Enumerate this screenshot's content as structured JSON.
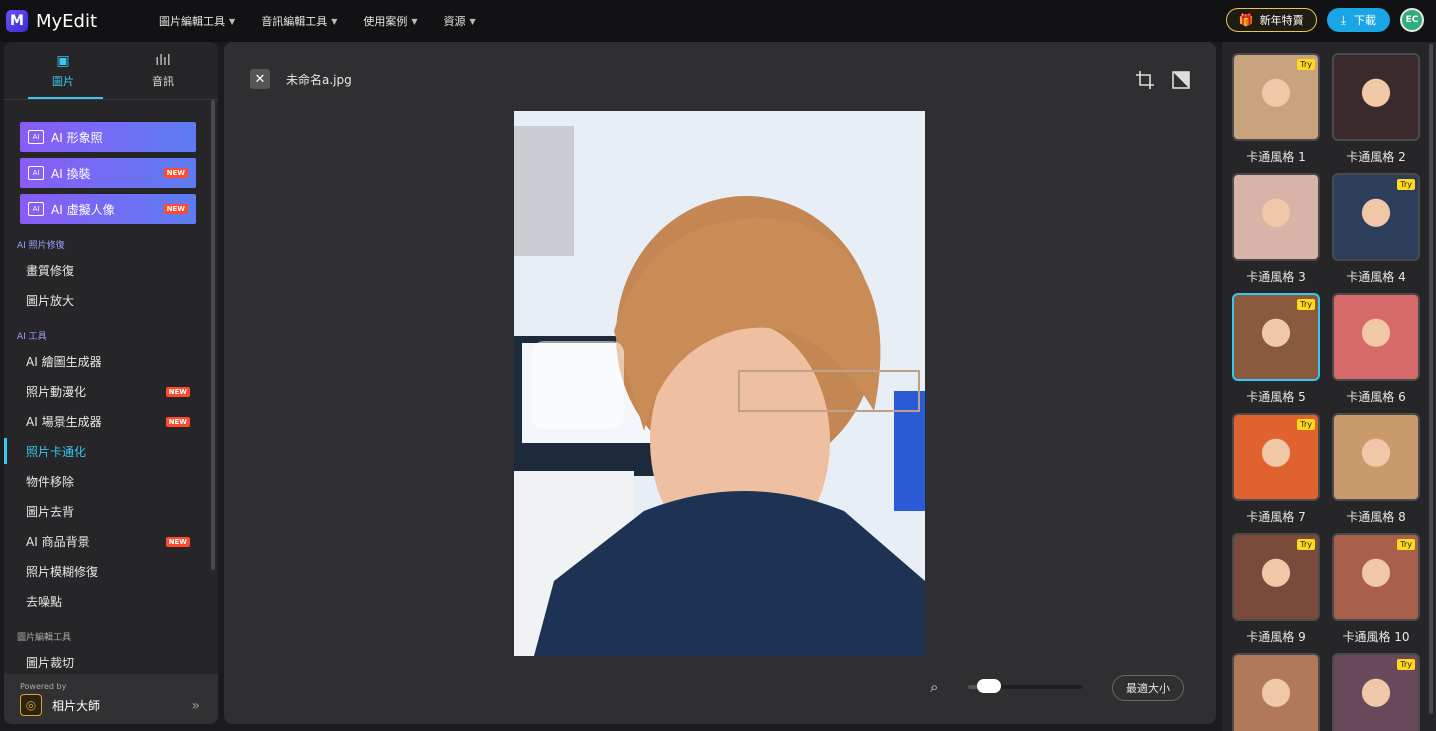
{
  "app": {
    "name": "MyEdit",
    "logo_letter": "M"
  },
  "nav": [
    {
      "label": "圖片編輯工具"
    },
    {
      "label": "音訊編輯工具"
    },
    {
      "label": "使用案例"
    },
    {
      "label": "資源"
    }
  ],
  "header": {
    "promo_label": "新年特賣",
    "download_label": "下載",
    "avatar_text": "EC"
  },
  "sidebar": {
    "tabs": [
      {
        "label": "圖片",
        "active": true
      },
      {
        "label": "音訊",
        "active": false
      }
    ],
    "ai_buttons": [
      {
        "label": "AI 形象照",
        "new": false
      },
      {
        "label": "AI 換裝",
        "new": true
      },
      {
        "label": "AI 虛擬人像",
        "new": true
      }
    ],
    "new_badge": "NEW",
    "sections": [
      {
        "title": "AI 照片修復",
        "items": [
          {
            "label": "畫質修復"
          },
          {
            "label": "圖片放大"
          }
        ]
      },
      {
        "title": "AI 工具",
        "items": [
          {
            "label": "AI 繪圖生成器"
          },
          {
            "label": "照片動漫化",
            "new": true
          },
          {
            "label": "AI 場景生成器",
            "new": true
          },
          {
            "label": "照片卡通化",
            "active": true
          },
          {
            "label": "物件移除"
          },
          {
            "label": "圖片去背"
          },
          {
            "label": "AI 商品背景",
            "new": true
          },
          {
            "label": "照片模糊修復"
          },
          {
            "label": "去噪點"
          }
        ]
      },
      {
        "title": "圖片編輯工具",
        "items": [
          {
            "label": "圖片裁切"
          }
        ]
      }
    ],
    "powered": {
      "label": "Powered by",
      "brand": "相片大師"
    }
  },
  "editor": {
    "filename": "未命名a.jpg",
    "zoom": {
      "level": 0.1
    },
    "fit_label": "最適大小"
  },
  "styles": [
    {
      "name": "卡通風格 1",
      "try": true,
      "color": "#c9a27e"
    },
    {
      "name": "卡通風格 2",
      "try": false,
      "color": "#3a2a2c"
    },
    {
      "name": "卡通風格 3",
      "try": false,
      "color": "#d8b4a8"
    },
    {
      "name": "卡通風格 4",
      "try": true,
      "color": "#2d3e5a"
    },
    {
      "name": "卡通風格 5",
      "try": true,
      "color": "#8a5a3c",
      "selected": true
    },
    {
      "name": "卡通風格 6",
      "try": false,
      "color": "#d76a6a"
    },
    {
      "name": "卡通風格 7",
      "try": true,
      "color": "#e0622e"
    },
    {
      "name": "卡通風格 8",
      "try": false,
      "color": "#c99a6a"
    },
    {
      "name": "卡通風格 9",
      "try": true,
      "color": "#7a4a3a"
    },
    {
      "name": "卡通風格 10",
      "try": true,
      "color": "#a8604a"
    },
    {
      "name": "",
      "try": false,
      "color": "#b07a5a"
    },
    {
      "name": "",
      "try": true,
      "color": "#6a4a5a"
    }
  ],
  "try_label": "Try"
}
